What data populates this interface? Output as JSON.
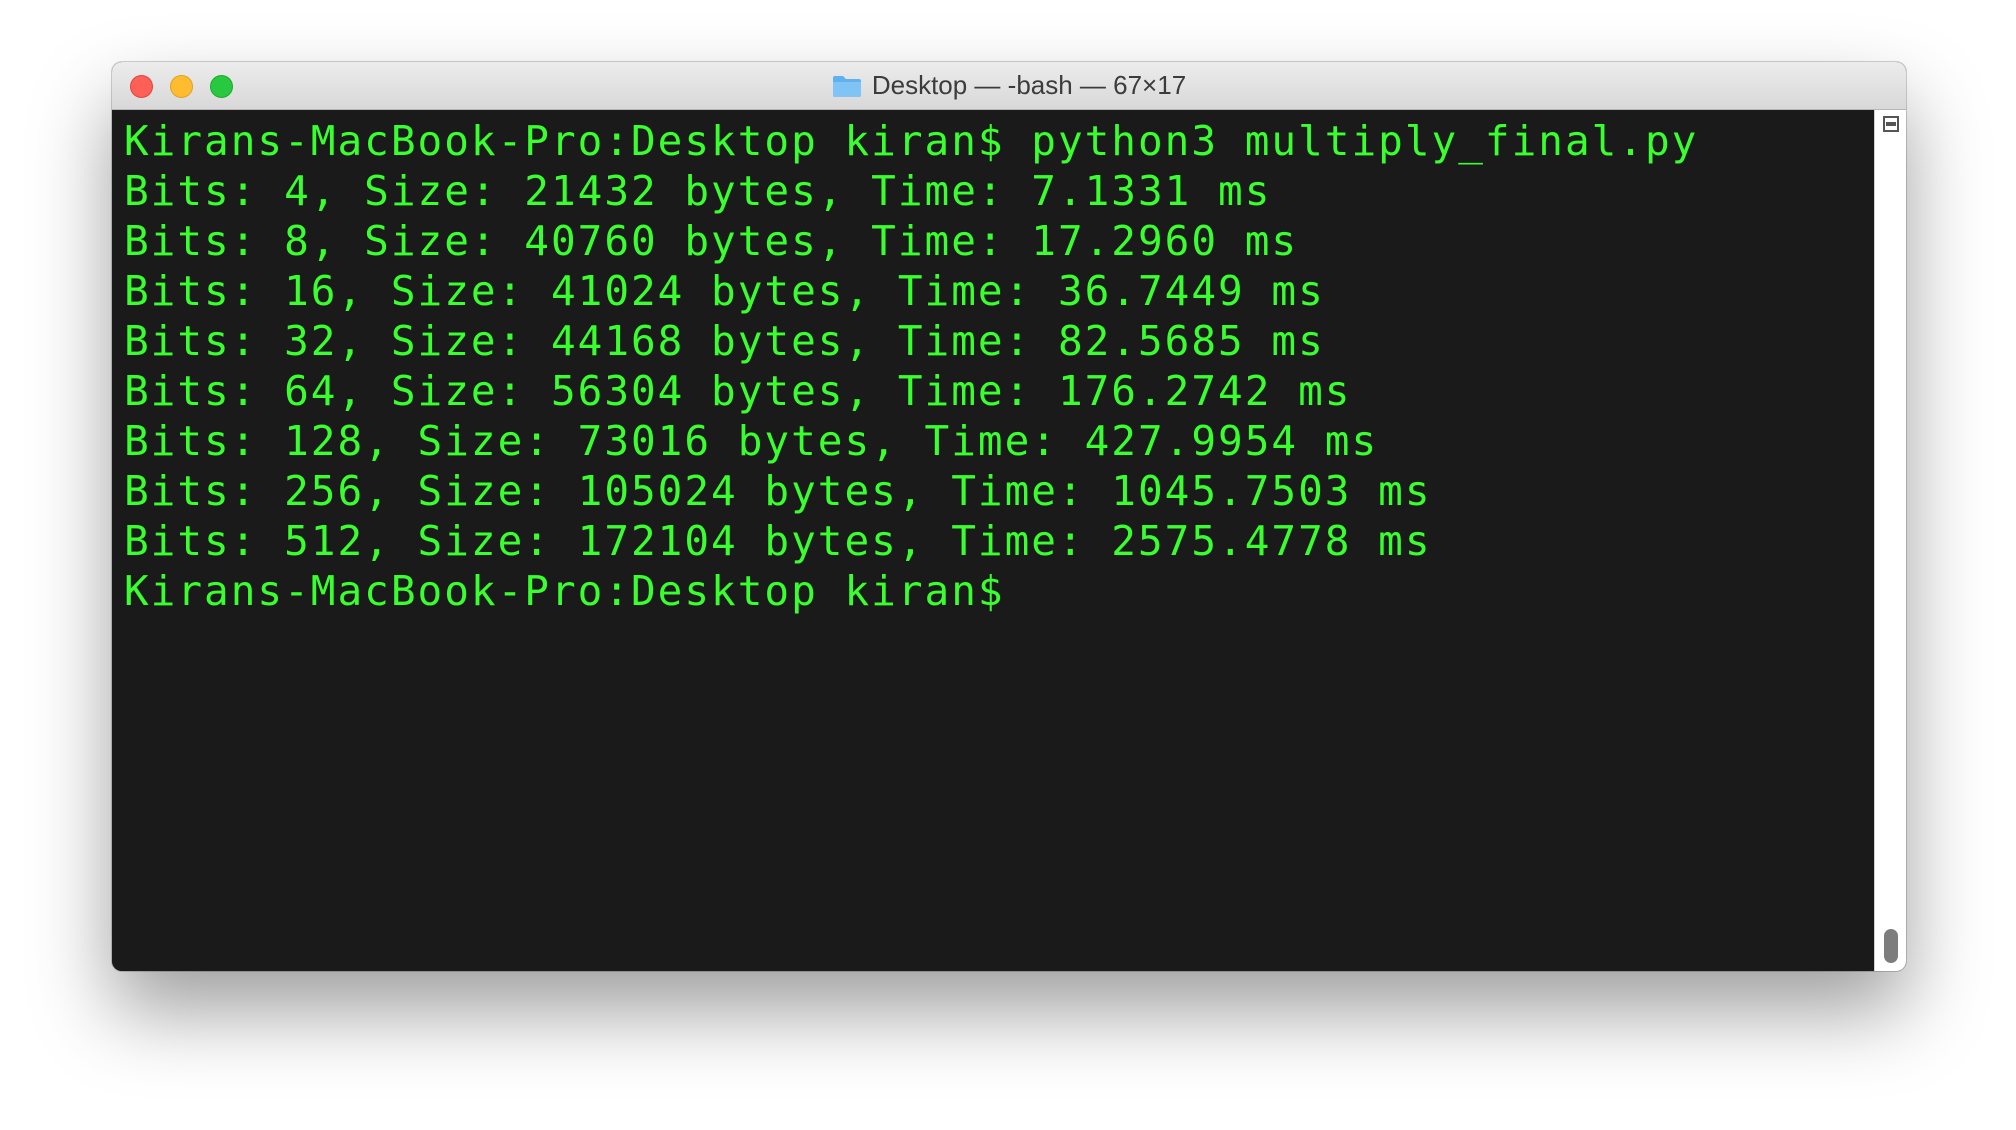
{
  "window": {
    "title": "Desktop — -bash — 67×17"
  },
  "terminal": {
    "lines": [
      "Kirans-MacBook-Pro:Desktop kiran$ python3 multiply_final.py",
      "Bits: 4, Size: 21432 bytes, Time: 7.1331 ms",
      "Bits: 8, Size: 40760 bytes, Time: 17.2960 ms",
      "Bits: 16, Size: 41024 bytes, Time: 36.7449 ms",
      "Bits: 32, Size: 44168 bytes, Time: 82.5685 ms",
      "Bits: 64, Size: 56304 bytes, Time: 176.2742 ms",
      "Bits: 128, Size: 73016 bytes, Time: 427.9954 ms",
      "Bits: 256, Size: 105024 bytes, Time: 1045.7503 ms",
      "Bits: 512, Size: 172104 bytes, Time: 2575.4778 ms",
      "Kirans-MacBook-Pro:Desktop kiran$"
    ],
    "text_color": "#39ff2e",
    "background_color": "#1a1a1a"
  },
  "icons": {
    "title_icon": "folder-icon",
    "scroll_split": "split-pane-icon"
  }
}
